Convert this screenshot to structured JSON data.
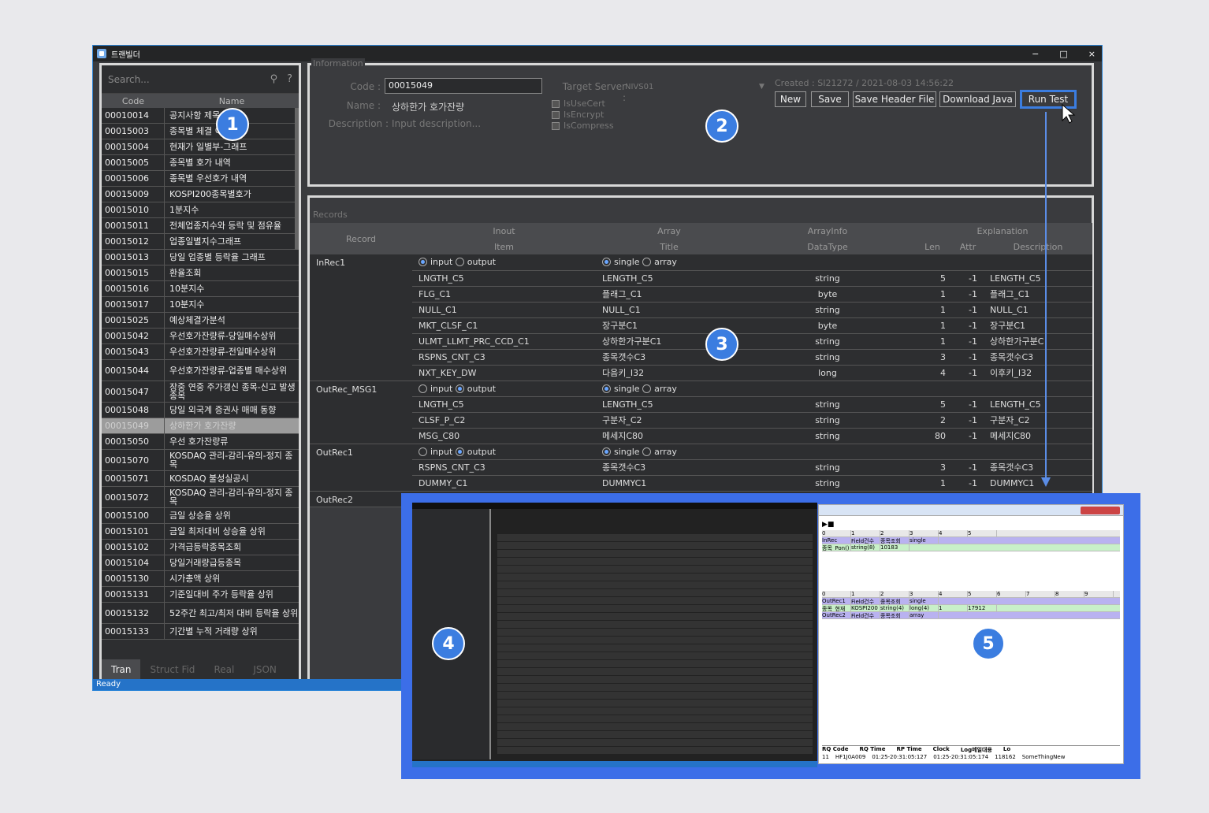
{
  "app": {
    "title": "트랜빌더",
    "window_buttons": [
      "−",
      "□",
      "×"
    ],
    "status": "Ready"
  },
  "sidebar": {
    "search_placeholder": "Search...",
    "search_icons": [
      "search-icon",
      "help-icon"
    ],
    "columns": [
      "Code",
      "Name"
    ],
    "rows": [
      {
        "code": "00010014",
        "name": "공지사항 제목"
      },
      {
        "code": "00015003",
        "name": "종목별 체결 이 List"
      },
      {
        "code": "00015004",
        "name": "현재가 일별부-그래프"
      },
      {
        "code": "00015005",
        "name": "종목별 호가 내역"
      },
      {
        "code": "00015006",
        "name": "종목별 우선호가 내역"
      },
      {
        "code": "00015009",
        "name": "KOSPI200종목별호가"
      },
      {
        "code": "00015010",
        "name": "1분지수"
      },
      {
        "code": "00015011",
        "name": "전체업종지수와 등락 및 점유율"
      },
      {
        "code": "00015012",
        "name": "업종일별지수그래프"
      },
      {
        "code": "00015013",
        "name": "당일 업종별 등락율 그래프"
      },
      {
        "code": "00015015",
        "name": "환율조회"
      },
      {
        "code": "00015016",
        "name": "10분지수"
      },
      {
        "code": "00015017",
        "name": "10분지수"
      },
      {
        "code": "00015025",
        "name": "예상체결가분석"
      },
      {
        "code": "00015042",
        "name": "우선호가잔량류-당일매수상위"
      },
      {
        "code": "00015043",
        "name": "우선호가잔량류-전일매수상위"
      },
      {
        "code": "00015044",
        "name": "우선호가잔량류-업종별 매수상위"
      },
      {
        "code": "00015047",
        "name": "장중 연중 주가갱신 종목-신고 발생종목"
      },
      {
        "code": "00015048",
        "name": "당일 외국계 증권사 매매 동향"
      },
      {
        "code": "00015049",
        "name": "상하한가 호가잔량"
      },
      {
        "code": "00015050",
        "name": "우선 호가잔량류"
      },
      {
        "code": "00015070",
        "name": "KOSDAQ 관리-감리-유의-정지 종목"
      },
      {
        "code": "00015071",
        "name": "KOSDAQ 불성실공시"
      },
      {
        "code": "00015072",
        "name": "KOSDAQ 관리-감리-유의-정지 종목"
      },
      {
        "code": "00015100",
        "name": "금일 상승율 상위"
      },
      {
        "code": "00015101",
        "name": "금일 최저대비 상승율 상위"
      },
      {
        "code": "00015102",
        "name": "가격급등락종목조회"
      },
      {
        "code": "00015104",
        "name": "당일거래량급등종목"
      },
      {
        "code": "00015130",
        "name": "시가총액 상위"
      },
      {
        "code": "00015131",
        "name": "기준일대비 주가 등락율 상위"
      },
      {
        "code": "00015132",
        "name": "52주간 최고/최저 대비 등락율 상위"
      },
      {
        "code": "00015133",
        "name": "기간별 누적 거래량 상위"
      }
    ],
    "tabs": [
      "Tran",
      "Struct Fid",
      "Real",
      "JSON"
    ]
  },
  "info": {
    "legend": "Information",
    "code_label": "Code :",
    "code_value": "00015049",
    "name_label": "Name :",
    "name_value": "상하한가 호가잔량",
    "desc_label": "Description :",
    "desc_placeholder": "Input description...",
    "target_label": "Target Server :",
    "target_value": "NIVS01",
    "checks": [
      "IsUseCert",
      "IsEncrypt",
      "IsCompress"
    ],
    "created": "Created : SI21272 / 2021-08-03 14:56:22",
    "buttons": [
      "New",
      "Save",
      "Save Header File",
      "Download Java",
      "Run Test"
    ]
  },
  "records": {
    "legend": "Records",
    "head1": [
      "Record",
      "Inout",
      "Array",
      "ArrayInfo",
      "Explanation"
    ],
    "head2": [
      "Item",
      "Title",
      "DataType",
      "Len",
      "Attr",
      "Description"
    ],
    "radio_labels": [
      "input",
      "output",
      "single",
      "array"
    ],
    "groups": [
      {
        "name": "InRec1",
        "inout": "input",
        "array": "single",
        "rows": [
          [
            "LNGTH_C5",
            "LENGTH_C5",
            "string",
            "5",
            "-1",
            "LENGTH_C5"
          ],
          [
            "FLG_C1",
            "플래그_C1",
            "byte",
            "1",
            "-1",
            "플래그_C1"
          ],
          [
            "NULL_C1",
            "NULL_C1",
            "string",
            "1",
            "-1",
            "NULL_C1"
          ],
          [
            "MKT_CLSF_C1",
            "장구분C1",
            "byte",
            "1",
            "-1",
            "장구분C1"
          ],
          [
            "ULMT_LLMT_PRC_CCD_C1",
            "상하한가구분C1",
            "string",
            "1",
            "-1",
            "상하한가구분C"
          ],
          [
            "RSPNS_CNT_C3",
            "종목갯수C3",
            "string",
            "3",
            "-1",
            "종목갯수C3"
          ],
          [
            "NXT_KEY_DW",
            "다음키_I32",
            "long",
            "4",
            "-1",
            "이후키_I32"
          ]
        ]
      },
      {
        "name": "OutRec_MSG1",
        "inout": "output",
        "array": "single",
        "rows": [
          [
            "LNGTH_C5",
            "LENGTH_C5",
            "string",
            "5",
            "-1",
            "LENGTH_C5"
          ],
          [
            "CLSF_P_C2",
            "구분자_C2",
            "string",
            "2",
            "-1",
            "구분자_C2"
          ],
          [
            "MSG_C80",
            "메세지C80",
            "string",
            "80",
            "-1",
            "메세지C80"
          ]
        ]
      },
      {
        "name": "OutRec1",
        "inout": "output",
        "array": "single",
        "rows": [
          [
            "RSPNS_CNT_C3",
            "종목갯수C3",
            "string",
            "3",
            "-1",
            "종목갯수C3"
          ],
          [
            "DUMMY_C1",
            "DUMMYC1",
            "string",
            "1",
            "-1",
            "DUMMYC1"
          ]
        ]
      },
      {
        "name": "OutRec2",
        "inout": "",
        "array": "",
        "rows": []
      }
    ]
  },
  "badges": [
    "1",
    "2",
    "3",
    "4",
    "5"
  ],
  "test_window": {
    "headers": [
      "0",
      "1",
      "2",
      "3",
      "4",
      "5",
      "6",
      "7",
      "8",
      "9"
    ],
    "inrec": [
      "InRec",
      "Field건수",
      "종목조회",
      "single"
    ],
    "inrec_vals": [
      "종목_Pon()",
      "string(8)",
      "10183"
    ],
    "outrec1": [
      "OutRec1",
      "Field건수",
      "종목조회",
      "single"
    ],
    "outrec1_vals": [
      "종목_현재",
      "KOSPI200",
      "string(4)",
      "long(4)",
      "1",
      "17912"
    ],
    "outrec2": [
      "OutRec2",
      "Field건수",
      "종목조회",
      "array"
    ],
    "log_head": [
      "RQ Code",
      "RQ Time",
      "RP Time",
      "Clock",
      "Log메일대용",
      "Lo"
    ],
    "log_row": [
      "11",
      "HF1J0A009",
      "01:25-20:31:05:127",
      "01:25-20:31:05:174",
      "118162",
      "SomeThingNew"
    ]
  }
}
